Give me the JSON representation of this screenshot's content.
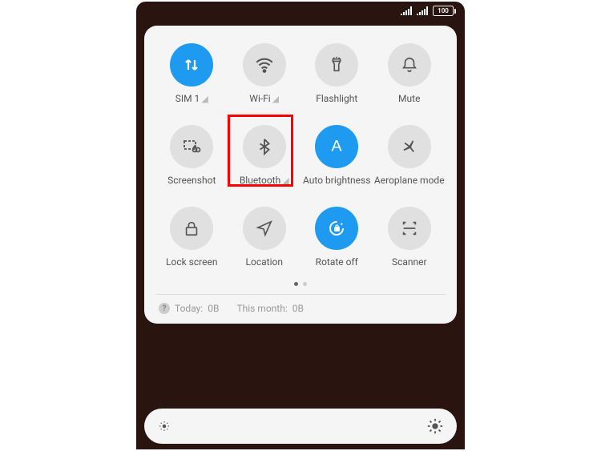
{
  "status": {
    "battery": "100"
  },
  "tiles": [
    {
      "label": "SIM 1",
      "hasCaret": true
    },
    {
      "label": "Wi-Fi",
      "hasCaret": true
    },
    {
      "label": "Flashlight",
      "hasCaret": false
    },
    {
      "label": "Mute",
      "hasCaret": false
    },
    {
      "label": "Screenshot",
      "hasCaret": false
    },
    {
      "label": "Bluetooth",
      "hasCaret": true
    },
    {
      "label": "Auto brightness",
      "hasCaret": false
    },
    {
      "label": "Aeroplane mode",
      "hasCaret": false
    },
    {
      "label": "Lock screen",
      "hasCaret": false
    },
    {
      "label": "Location",
      "hasCaret": false
    },
    {
      "label": "Rotate off",
      "hasCaret": false
    },
    {
      "label": "Scanner",
      "hasCaret": false
    }
  ],
  "usage": {
    "today_label": "Today:",
    "today_value": "0B",
    "month_label": "This month:",
    "month_value": "0B"
  }
}
